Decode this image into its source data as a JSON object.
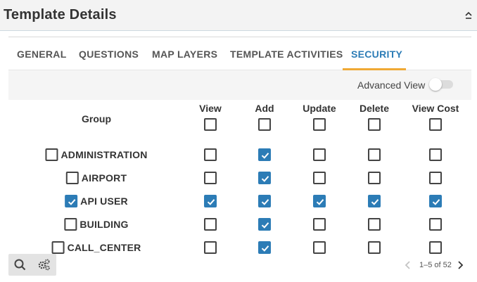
{
  "header": {
    "title": "Template Details"
  },
  "tabs": [
    {
      "label": "GENERAL"
    },
    {
      "label": "QUESTIONS"
    },
    {
      "label": "MAP LAYERS"
    },
    {
      "label": "TEMPLATE ACTIVITIES"
    },
    {
      "label": "SECURITY",
      "active": true
    }
  ],
  "toolbar": {
    "advanced_view_label": "Advanced View",
    "advanced_view_on": false
  },
  "table": {
    "group_header": "Group",
    "columns": [
      "View",
      "Add",
      "Update",
      "Delete",
      "View Cost"
    ],
    "header_checks": [
      false,
      false,
      false,
      false,
      false
    ],
    "rows": [
      {
        "group": "ADMINISTRATION",
        "selected": false,
        "perms": [
          false,
          true,
          false,
          false,
          false
        ]
      },
      {
        "group": "AIRPORT",
        "selected": false,
        "perms": [
          false,
          true,
          false,
          false,
          false
        ]
      },
      {
        "group": "API USER",
        "selected": true,
        "perms": [
          true,
          true,
          true,
          true,
          true
        ]
      },
      {
        "group": "BUILDING",
        "selected": false,
        "perms": [
          false,
          true,
          false,
          false,
          false
        ]
      },
      {
        "group": "CALL_CENTER",
        "selected": false,
        "perms": [
          false,
          true,
          false,
          false,
          false
        ]
      }
    ]
  },
  "footer": {
    "icons": [
      "search-icon",
      "settings-icon"
    ],
    "pager": "1–5 of 52"
  },
  "colors": {
    "accent": "#2c7cb6",
    "tab_underline": "#f0a935",
    "check_fill": "#2c7cb6"
  }
}
